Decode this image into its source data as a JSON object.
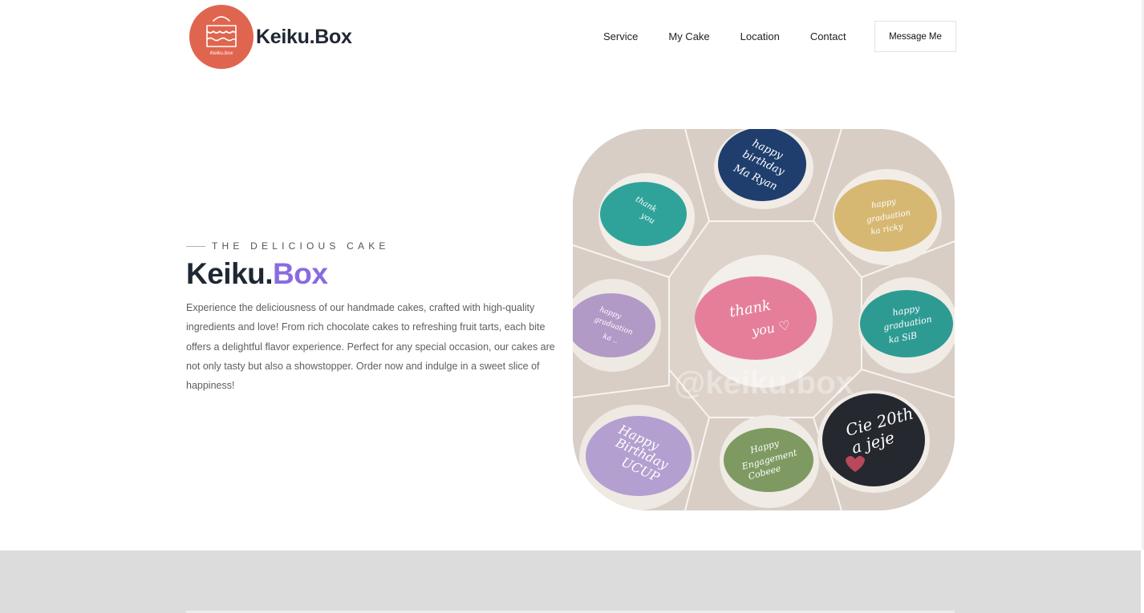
{
  "brand": {
    "name": "Keiku.Box",
    "logo_icon": "cake-box-icon",
    "logo_color": "#e0654f"
  },
  "nav": {
    "items": [
      {
        "label": "Service"
      },
      {
        "label": "My Cake"
      },
      {
        "label": "Location"
      },
      {
        "label": "Contact"
      }
    ],
    "cta_label": "Message Me"
  },
  "hero": {
    "eyebrow": "THE DELICIOUS CAKE",
    "title_main": "Keiku.",
    "title_accent": "Box",
    "accent_color": "#8a6bdf",
    "description": "Experience the deliciousness of our handmade cakes, crafted with high-quality ingredients and love! From rich chocolate cakes to refreshing fruit tarts, each bite offers a delightful flavor experience. Perfect for any special occasion, our cakes are not only tasty but also a showstopper. Order now and indulge in a sweet slice of happiness!"
  },
  "collage": {
    "cakes": [
      {
        "text": "happy birthday Ma Ryan",
        "color": "#1f3e6e"
      },
      {
        "text": "thank you",
        "color": "#2fa39a"
      },
      {
        "text": "happy graduation ka ricky",
        "color": "#d6b872"
      },
      {
        "text": "happy graduation",
        "color": "#b29ac6"
      },
      {
        "text": "thank you",
        "color": "#e57f99"
      },
      {
        "text": "happy graduation ka SiB",
        "color": "#2e9b93"
      },
      {
        "text": "Happy Birthday UCUP",
        "color": "#b39fd0"
      },
      {
        "text": "Happy Engagement Cobeee",
        "color": "#7e9a62"
      },
      {
        "text": "Cie 20th a jeje",
        "color": "#25282e"
      }
    ],
    "watermark": "@keiku.box"
  }
}
